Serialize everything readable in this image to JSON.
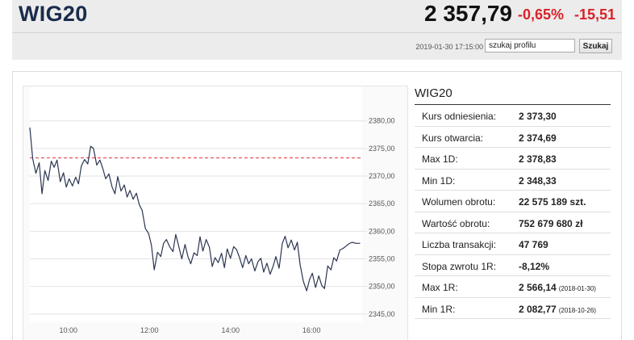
{
  "header": {
    "index_name": "WIG20",
    "value": "2 357,79",
    "change_pct": "-0,65%",
    "change_abs": "-15,51",
    "timestamp": "2019-01-30 17:15:00",
    "search_value": "szukaj profilu",
    "search_button": "Szukaj",
    "negative_color": "#d8232a"
  },
  "stats": {
    "title": "WIG20",
    "rows": [
      {
        "label": "Kurs odniesienia:",
        "value": "2 373,30",
        "date": ""
      },
      {
        "label": "Kurs otwarcia:",
        "value": "2 374,69",
        "date": ""
      },
      {
        "label": "Max 1D:",
        "value": "2 378,83",
        "date": ""
      },
      {
        "label": "Min 1D:",
        "value": "2 348,33",
        "date": ""
      },
      {
        "label": "Wolumen obrotu:",
        "value": "22 575 189 szt.",
        "date": ""
      },
      {
        "label": "Wartość obrotu:",
        "value": "752 679 680 zł",
        "date": ""
      },
      {
        "label": "Liczba transakcji:",
        "value": "47 769",
        "date": ""
      },
      {
        "label": "Stopa zwrotu 1R:",
        "value": "-8,12%",
        "date": ""
      },
      {
        "label": "Max 1R:",
        "value": "2 566,14",
        "date": "(2018-01-30)"
      },
      {
        "label": "Min 1R:",
        "value": "2 082,77",
        "date": "(2018-10-26)"
      }
    ]
  },
  "chart_data": {
    "type": "line",
    "x_ticks": [
      "10:00",
      "12:00",
      "14:00",
      "16:00"
    ],
    "x_tick_hours": [
      10,
      12,
      14,
      16
    ],
    "x_range_hours": [
      9.05,
      17.25
    ],
    "y_ticks": [
      "2380,00",
      "2375,00",
      "2370,00",
      "2365,00",
      "2360,00",
      "2355,00",
      "2350,00",
      "2345,00"
    ],
    "y_tick_values": [
      2380,
      2375,
      2370,
      2365,
      2360,
      2355,
      2350,
      2345
    ],
    "ylim": [
      2343.5,
      2384.5
    ],
    "reference_line": 2373.3,
    "reference_color": "#e0393e",
    "line_color": "#2a3550",
    "grid": "horizontal",
    "x": [
      9.05,
      9.12,
      9.2,
      9.28,
      9.35,
      9.42,
      9.5,
      9.58,
      9.65,
      9.72,
      9.8,
      9.88,
      9.95,
      10.02,
      10.1,
      10.18,
      10.25,
      10.32,
      10.4,
      10.48,
      10.55,
      10.62,
      10.7,
      10.78,
      10.85,
      10.92,
      11.0,
      11.08,
      11.15,
      11.22,
      11.3,
      11.38,
      11.45,
      11.52,
      11.6,
      11.68,
      11.75,
      11.82,
      11.9,
      11.98,
      12.05,
      12.12,
      12.2,
      12.28,
      12.35,
      12.42,
      12.5,
      12.58,
      12.65,
      12.72,
      12.8,
      12.88,
      12.95,
      13.02,
      13.1,
      13.18,
      13.25,
      13.32,
      13.4,
      13.48,
      13.55,
      13.62,
      13.7,
      13.78,
      13.85,
      13.92,
      14.0,
      14.08,
      14.15,
      14.22,
      14.3,
      14.38,
      14.45,
      14.52,
      14.6,
      14.68,
      14.75,
      14.82,
      14.9,
      14.98,
      15.05,
      15.12,
      15.2,
      15.28,
      15.35,
      15.42,
      15.5,
      15.58,
      15.65,
      15.72,
      15.8,
      15.88,
      15.95,
      16.02,
      16.1,
      16.18,
      16.25,
      16.32,
      16.4,
      16.48,
      16.55,
      16.62,
      16.7,
      16.78,
      16.85,
      16.92,
      17.0,
      17.1,
      17.2
    ],
    "y": [
      2378.8,
      2373.2,
      2370.5,
      2372.4,
      2366.8,
      2371.0,
      2369.2,
      2372.7,
      2371.6,
      2372.9,
      2369.0,
      2370.6,
      2368.0,
      2369.5,
      2368.2,
      2369.8,
      2368.6,
      2371.8,
      2373.0,
      2372.2,
      2375.4,
      2375.0,
      2372.0,
      2372.9,
      2371.4,
      2369.5,
      2370.4,
      2368.0,
      2366.8,
      2369.9,
      2367.3,
      2368.4,
      2366.2,
      2367.4,
      2365.8,
      2366.9,
      2364.8,
      2363.8,
      2360.5,
      2359.6,
      2357.5,
      2353.0,
      2356.2,
      2355.4,
      2357.8,
      2358.5,
      2357.2,
      2356.3,
      2359.4,
      2357.4,
      2355.0,
      2357.6,
      2355.4,
      2354.1,
      2356.1,
      2355.6,
      2359.0,
      2356.4,
      2358.5,
      2357.1,
      2353.6,
      2355.2,
      2354.3,
      2356.0,
      2353.4,
      2356.8,
      2355.1,
      2357.2,
      2356.7,
      2355.3,
      2353.4,
      2355.6,
      2354.1,
      2355.0,
      2352.8,
      2354.5,
      2355.1,
      2352.6,
      2354.2,
      2352.2,
      2353.6,
      2355.4,
      2353.3,
      2357.8,
      2359.1,
      2357.0,
      2358.4,
      2356.6,
      2358.0,
      2353.9,
      2350.9,
      2349.2,
      2351.2,
      2352.4,
      2349.8,
      2351.9,
      2350.2,
      2349.6,
      2353.7,
      2353.0,
      2355.2,
      2354.6,
      2356.6,
      2356.9,
      2357.3,
      2357.7,
      2358.0,
      2357.8,
      2357.8
    ]
  }
}
